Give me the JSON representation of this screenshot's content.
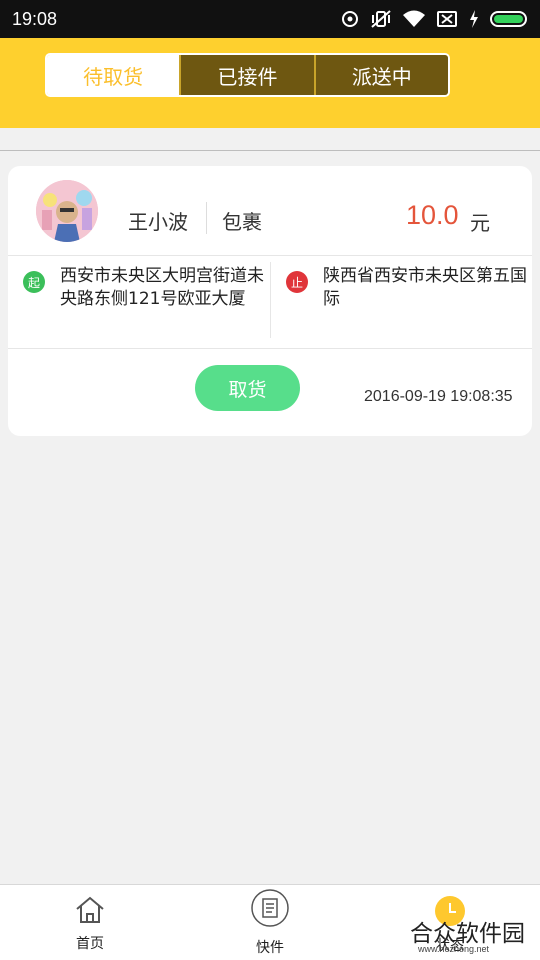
{
  "statusbar": {
    "time": "19:08"
  },
  "tabs": [
    {
      "label": "待取货",
      "active": true
    },
    {
      "label": "已接件",
      "active": false
    },
    {
      "label": "派送中",
      "active": false
    }
  ],
  "order": {
    "sender_name": "王小波",
    "item_type": "包裹",
    "price": "10.0",
    "price_unit": "元",
    "start_badge": "起",
    "end_badge": "止",
    "from_address": "西安市未央区大明宫街道未央路东侧121号欧亚大厦",
    "to_address": "陕西省西安市未央区第五国际",
    "action_label": "取货",
    "timestamp": "2016-09-19 19:08:35"
  },
  "bottom_nav": {
    "home": "首页",
    "express": "快件",
    "status": "状态"
  },
  "watermark": {
    "text": "合众软件园",
    "url": "www.hezhong.net"
  },
  "colors": {
    "header": "#fed02e",
    "price": "#e4553b",
    "button": "#57de8b",
    "start": "#3bbf5a",
    "end": "#e0353a"
  }
}
